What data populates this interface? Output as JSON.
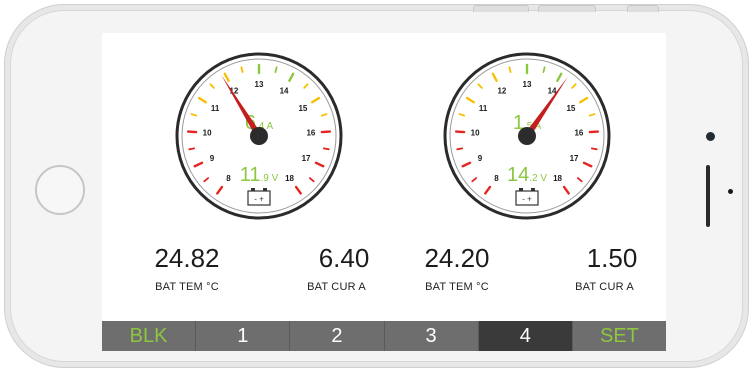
{
  "gauges": [
    {
      "ticks": [
        "8",
        "9",
        "10",
        "11",
        "12",
        "13",
        "14",
        "15",
        "16",
        "17",
        "18"
      ],
      "current_big": "6",
      "current_small": ".4",
      "current_unit": "A",
      "voltage_big": "11",
      "voltage_small": ".9",
      "voltage_unit": "V",
      "needle_value": 11.9,
      "battery_symbol": "- +"
    },
    {
      "ticks": [
        "8",
        "9",
        "10",
        "11",
        "12",
        "13",
        "14",
        "15",
        "16",
        "17",
        "18"
      ],
      "current_big": "1",
      "current_small": ".5",
      "current_unit": "A",
      "voltage_big": "14",
      "voltage_small": ".2",
      "voltage_unit": "V",
      "needle_value": 14.2,
      "battery_symbol": "- +"
    }
  ],
  "readouts": [
    {
      "value": "24.82",
      "label": "BAT TEM °C"
    },
    {
      "value": "6.40",
      "label": "BAT CUR  A"
    },
    {
      "value": "24.20",
      "label": "BAT TEM °C"
    },
    {
      "value": "1.50",
      "label": "BAT CUR  A"
    }
  ],
  "nav": [
    {
      "label": "BLK",
      "active": false,
      "green": true
    },
    {
      "label": "1",
      "active": false,
      "green": false
    },
    {
      "label": "2",
      "active": false,
      "green": false
    },
    {
      "label": "3",
      "active": false,
      "green": false
    },
    {
      "label": "4",
      "active": true,
      "green": false
    },
    {
      "label": "SET",
      "active": false,
      "green": true
    }
  ],
  "colors": {
    "accent_green": "#8dc63f",
    "tick_red": "#e52421",
    "tick_yellow": "#f6c000",
    "needle": "#c41e1e",
    "nav_bg": "#6e6e6e",
    "nav_active": "#3a3a3a"
  }
}
